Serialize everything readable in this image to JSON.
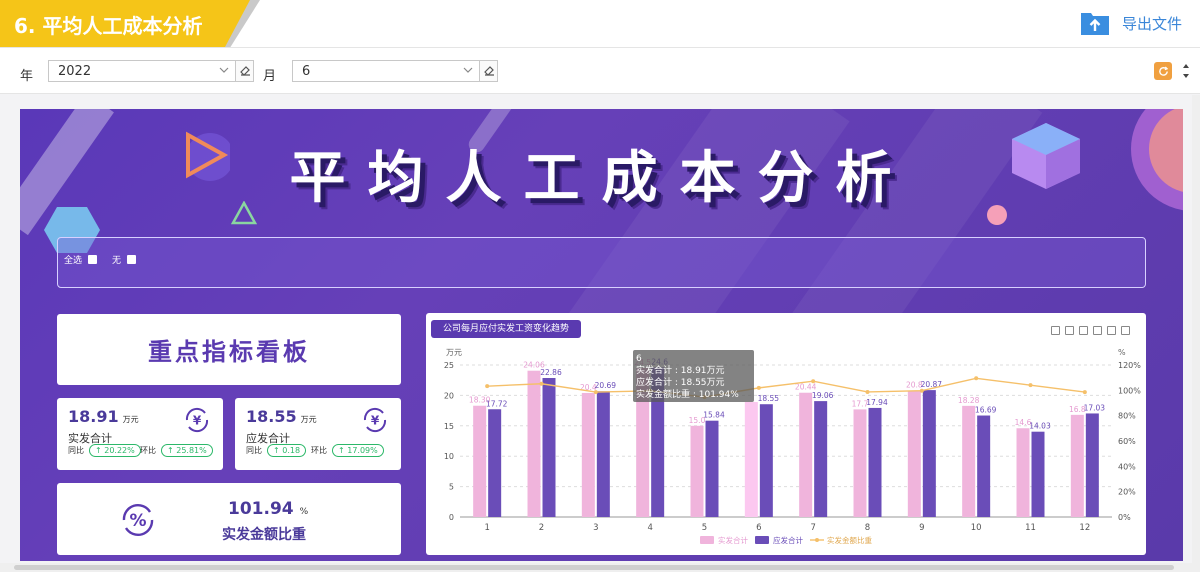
{
  "header": {
    "title": "6. 平均人工成本分析",
    "export_label": "导出文件"
  },
  "filters": {
    "year_label": "年",
    "year_value": "2022",
    "month_label": "月",
    "month_value": "6"
  },
  "dashboard": {
    "hero_title": "平均人工成本分析",
    "checkboxes": [
      {
        "label": "全选"
      },
      {
        "label": "无"
      }
    ],
    "kpi_board_title": "重点指标看板",
    "kpis": [
      {
        "value": "18.91",
        "unit": "万元",
        "name": "实发合计",
        "yoy_label": "同比",
        "yoy": "↑ 20.22%",
        "mom_label": "环比",
        "mom": "↑ 25.81%"
      },
      {
        "value": "18.55",
        "unit": "万元",
        "name": "应发合计",
        "yoy_label": "同比",
        "yoy": "↑ 0.18",
        "mom_label": "环比",
        "mom": "↑ 17.09%"
      }
    ],
    "ratio": {
      "value": "101.94",
      "unit": "%",
      "name": "实发金额比重"
    }
  },
  "tooltip": {
    "title": "6",
    "lines": [
      "实发合计 : 18.91万元",
      "应发合计 : 18.55万元",
      "实发金额比重 : 101.94%"
    ]
  },
  "colors": {
    "pink_bar": "#f0b4dc",
    "purple_bar": "#6a4db8",
    "line": "#f5c06a",
    "highlight_bar": "#fcc8f0"
  },
  "chart_data": {
    "type": "bar",
    "title": "公司每月应付实发工资变化趋势",
    "left_axis_unit": "万元",
    "right_axis_unit": "%",
    "ylim": [
      0,
      25
    ],
    "yticks": [
      0,
      5,
      10,
      15,
      20,
      25
    ],
    "y2lim": [
      0,
      120
    ],
    "y2ticks": [
      "0%",
      "20%",
      "40%",
      "60%",
      "80%",
      "100%",
      "120%"
    ],
    "categories": [
      "1",
      "2",
      "3",
      "4",
      "5",
      "6",
      "7",
      "8",
      "9",
      "10",
      "11",
      "12"
    ],
    "series": [
      {
        "name": "实发合计",
        "kind": "bar",
        "values": [
          18.3,
          24.06,
          20.4,
          24.5,
          15.0,
          18.91,
          20.44,
          17.7,
          20.8,
          18.28,
          14.6,
          16.8
        ],
        "labels": [
          "18.30",
          "24.06",
          "20.4",
          "24.5",
          "15.0",
          "",
          "20.44",
          "17.7",
          "20.8",
          "18.28",
          "14.6",
          "16.8"
        ]
      },
      {
        "name": "应发合计",
        "kind": "bar",
        "values": [
          17.72,
          22.86,
          20.69,
          24.6,
          15.84,
          18.55,
          19.06,
          17.94,
          20.87,
          16.69,
          14.03,
          17.03
        ],
        "labels": [
          "17.72",
          "22.86",
          "20.69",
          "24.6",
          "15.84",
          "18.55",
          "19.06",
          "17.94",
          "20.87",
          "16.69",
          "14.03",
          "17.03"
        ]
      },
      {
        "name": "实发金额比重",
        "kind": "line",
        "axis": "right",
        "values": [
          103.3,
          105.2,
          98.6,
          99.6,
          94.7,
          101.94,
          107.2,
          98.7,
          99.7,
          109.5,
          104.1,
          98.6
        ]
      }
    ],
    "highlight_index": 5,
    "legend_position": "bottom-center",
    "grid": true
  }
}
